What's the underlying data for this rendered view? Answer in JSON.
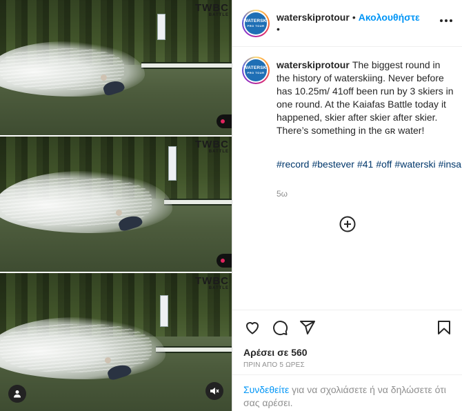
{
  "post": {
    "username": "waterskiprotour",
    "follow_label": "Ακολουθήστε",
    "header_separator": "•",
    "avatar_text": "WATERSKI",
    "avatar_subtext": "PRO TOUR",
    "caption": "The biggest round in the history of waterskiing. Never before has 10.25m/ 41off been run by 3 skiers in one round. At the Kaiafas Battle today it happened, skier after skier after skier. There’s something in the ɢʀ water!",
    "hashtags": [
      "#record",
      "#bestever",
      "#41",
      "#off",
      "#waterski",
      "#insane"
    ],
    "age": "5ω",
    "likes": "Αρέσει σε 560",
    "timestamp": "ΠΡΙΝ ΑΠΟ 5 ΩΡΕΣ",
    "login_link": "Συνδεθείτε",
    "login_text": " για να σχολιάσετε ή να δηλώσετε ότι σας αρέσει."
  },
  "media": {
    "watermark": "TWBC",
    "watermark_sub": "BATTLE"
  },
  "icons": {
    "like": "heart-icon",
    "comment": "comment-icon",
    "share": "paper-plane-icon",
    "save": "bookmark-icon",
    "more": "more-horizontal-icon",
    "load_more": "plus-circle-icon",
    "tag": "user-tag-icon",
    "mute": "speaker-muted-icon"
  },
  "colors": {
    "link_blue": "#0095f6",
    "hashtag": "#00376b",
    "muted": "#8e8e8e"
  }
}
